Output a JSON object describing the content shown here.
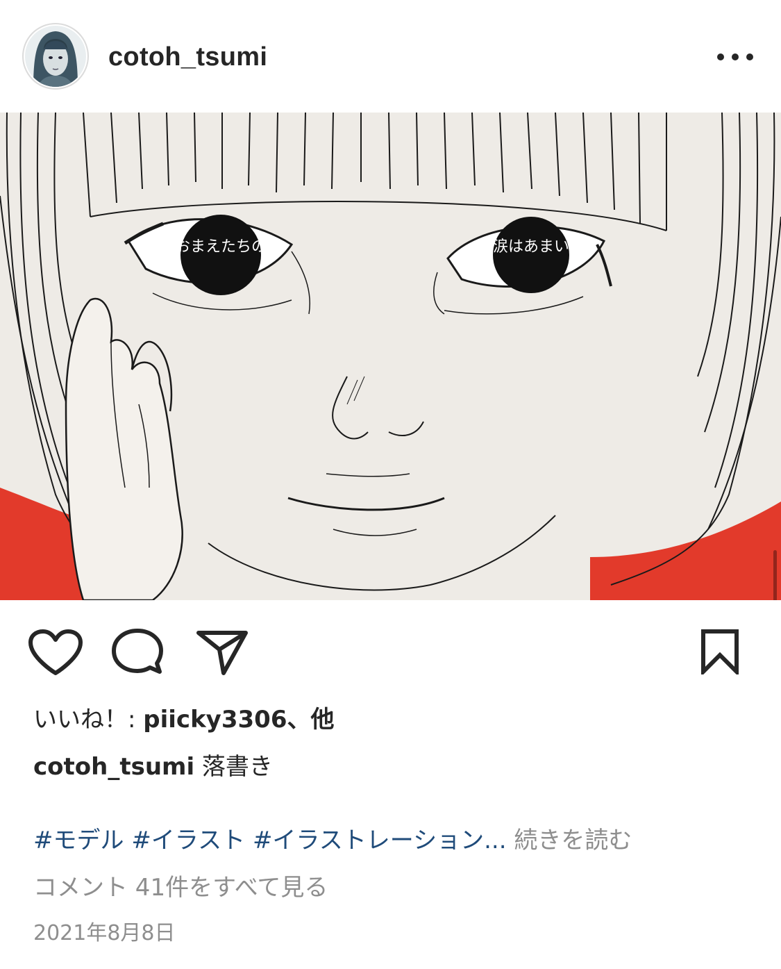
{
  "post": {
    "username": "cotoh_tsumi",
    "more_icon": "more-horizontal-icon",
    "image_alt": "illustration",
    "eye_text_left": "おまえたちの",
    "eye_text_right": "涙はあまい"
  },
  "actions": {
    "like_icon": "heart-icon",
    "comment_icon": "comment-bubble-icon",
    "share_icon": "paper-plane-icon",
    "save_icon": "bookmark-icon"
  },
  "likes": {
    "prefix": "いいね！: ",
    "user": "piicky3306、他"
  },
  "caption": {
    "user": "cotoh_tsumi",
    "text": " 落書き"
  },
  "hashtags": {
    "tags": [
      "#モデル",
      "#イラスト",
      "#イラストレーション"
    ],
    "ellipsis": "...",
    "read_more": "続きを読む"
  },
  "comments": {
    "view_all": "コメント 41件をすべて見る"
  },
  "date": "2021年8月8日",
  "colors": {
    "text": "#262626",
    "secondary": "#8e8e8e",
    "hashtag": "#1f4b7a",
    "background_red": "#e23a2b",
    "paper": "#eeebe6"
  }
}
